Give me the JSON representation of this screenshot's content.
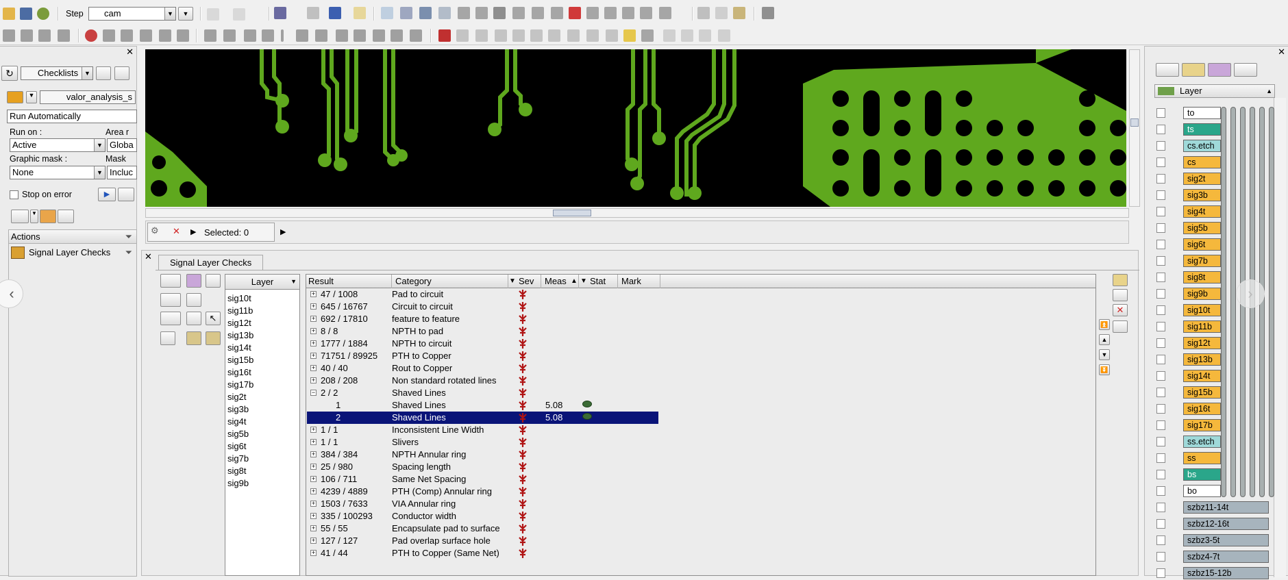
{
  "toolbar": {
    "step_label": "Step",
    "step_value": "cam",
    "selected_label": "Selected: 0"
  },
  "left_panel": {
    "checklists_label": "Checklists",
    "checklist_name": "valor_analysis_s",
    "run_mode": "Run Automatically",
    "run_on_label": "Run on :",
    "run_on_value": "Active",
    "area_label": "Area r",
    "area_value": "Globa",
    "graphic_mask_label": "Graphic mask :",
    "graphic_mask_value": "None",
    "mask_label": "Mask",
    "mask_value": "Incluc",
    "stop_on_error_label": "Stop on error",
    "actions_header": "Actions",
    "action_item": "Signal Layer Checks"
  },
  "checks": {
    "tab_label": "Signal Layer Checks",
    "layer_header": "Layer",
    "layers": [
      "sig10t",
      "sig11b",
      "sig12t",
      "sig13b",
      "sig14t",
      "sig15b",
      "sig16t",
      "sig17b",
      "sig2t",
      "sig3b",
      "sig4t",
      "sig5b",
      "sig6t",
      "sig7b",
      "sig8t",
      "sig9b"
    ],
    "columns": {
      "result": "Result",
      "category": "Category",
      "sev": "Sev",
      "meas": "Meas",
      "stat": "Stat",
      "mark": "Mark"
    },
    "rows": [
      {
        "result": "47 / 1008",
        "category": "Pad to circuit",
        "meas": "",
        "exp": "+"
      },
      {
        "result": "645 / 16767",
        "category": "Circuit to circuit",
        "meas": "",
        "exp": "+"
      },
      {
        "result": "692 / 17810",
        "category": "feature to feature",
        "meas": "",
        "exp": "+"
      },
      {
        "result": "8 / 8",
        "category": "NPTH to pad",
        "meas": "",
        "exp": "+"
      },
      {
        "result": "1777 / 1884",
        "category": "NPTH to circuit",
        "meas": "",
        "exp": "+"
      },
      {
        "result": "71751 / 89925",
        "category": "PTH to Copper",
        "meas": "",
        "exp": "+"
      },
      {
        "result": "40 / 40",
        "category": "Rout to Copper",
        "meas": "",
        "exp": "+"
      },
      {
        "result": "208 / 208",
        "category": "Non standard rotated lines",
        "meas": "",
        "exp": "+"
      },
      {
        "result": "2 / 2",
        "category": "Shaved Lines",
        "meas": "",
        "exp": "−"
      },
      {
        "result": "1",
        "category": "Shaved Lines",
        "meas": "5.08",
        "exp": ""
      },
      {
        "result": "2",
        "category": "Shaved Lines",
        "meas": "5.08",
        "exp": ""
      },
      {
        "result": "1 / 1",
        "category": "Inconsistent Line Width",
        "meas": "",
        "exp": "+"
      },
      {
        "result": "1 / 1",
        "category": "Slivers",
        "meas": "",
        "exp": "+"
      },
      {
        "result": "384 / 384",
        "category": "NPTH Annular ring",
        "meas": "",
        "exp": "+"
      },
      {
        "result": "25 / 980",
        "category": "Spacing length",
        "meas": "",
        "exp": "+"
      },
      {
        "result": "106 / 711",
        "category": "Same Net Spacing",
        "meas": "",
        "exp": "+"
      },
      {
        "result": "4239 / 4889",
        "category": "PTH (Comp) Annular ring",
        "meas": "",
        "exp": "+"
      },
      {
        "result": "1503 / 7633",
        "category": "VIA Annular ring",
        "meas": "",
        "exp": "+"
      },
      {
        "result": "335 / 100293",
        "category": "Conductor width",
        "meas": "",
        "exp": "+"
      },
      {
        "result": "55 / 55",
        "category": "Encapsulate pad to surface",
        "meas": "",
        "exp": "+"
      },
      {
        "result": "127 / 127",
        "category": "Pad overlap surface hole",
        "meas": "",
        "exp": "+"
      },
      {
        "result": "41 / 44",
        "category": "PTH to Copper (Same Net)",
        "meas": "",
        "exp": "+"
      }
    ]
  },
  "layer_panel": {
    "header": "Layer",
    "layers": [
      {
        "name": "to",
        "color": "#ffffff"
      },
      {
        "name": "ts",
        "color": "#2aa68a"
      },
      {
        "name": "cs.etch",
        "color": "#9fd9d9"
      },
      {
        "name": "cs",
        "color": "#f5b83c"
      },
      {
        "name": "sig2t",
        "color": "#f5b83c"
      },
      {
        "name": "sig3b",
        "color": "#f5b83c"
      },
      {
        "name": "sig4t",
        "color": "#f5b83c"
      },
      {
        "name": "sig5b",
        "color": "#f5b83c"
      },
      {
        "name": "sig6t",
        "color": "#f5b83c"
      },
      {
        "name": "sig7b",
        "color": "#f5b83c"
      },
      {
        "name": "sig8t",
        "color": "#f5b83c"
      },
      {
        "name": "sig9b",
        "color": "#f5b83c"
      },
      {
        "name": "sig10t",
        "color": "#f5b83c"
      },
      {
        "name": "sig11b",
        "color": "#f5b83c"
      },
      {
        "name": "sig12t",
        "color": "#f5b83c"
      },
      {
        "name": "sig13b",
        "color": "#f5b83c"
      },
      {
        "name": "sig14t",
        "color": "#f5b83c"
      },
      {
        "name": "sig15b",
        "color": "#f5b83c"
      },
      {
        "name": "sig16t",
        "color": "#f5b83c"
      },
      {
        "name": "sig17b",
        "color": "#f5b83c"
      },
      {
        "name": "ss.etch",
        "color": "#9fd9d9"
      },
      {
        "name": "ss",
        "color": "#f5b83c"
      },
      {
        "name": "bs",
        "color": "#2aa68a"
      },
      {
        "name": "bo",
        "color": "#ffffff"
      },
      {
        "name": "szbz11-14t",
        "color": "#a7b4bd"
      },
      {
        "name": "szbz12-16t",
        "color": "#a7b4bd"
      },
      {
        "name": "szbz3-5t",
        "color": "#a7b4bd"
      },
      {
        "name": "szbz4-7t",
        "color": "#a7b4bd"
      },
      {
        "name": "szbz15-12b",
        "color": "#a7b4bd"
      }
    ]
  },
  "colors": {
    "board_green": "#5fa81e",
    "selection_blue": "#0a1478",
    "sev_red": "#b01414"
  }
}
